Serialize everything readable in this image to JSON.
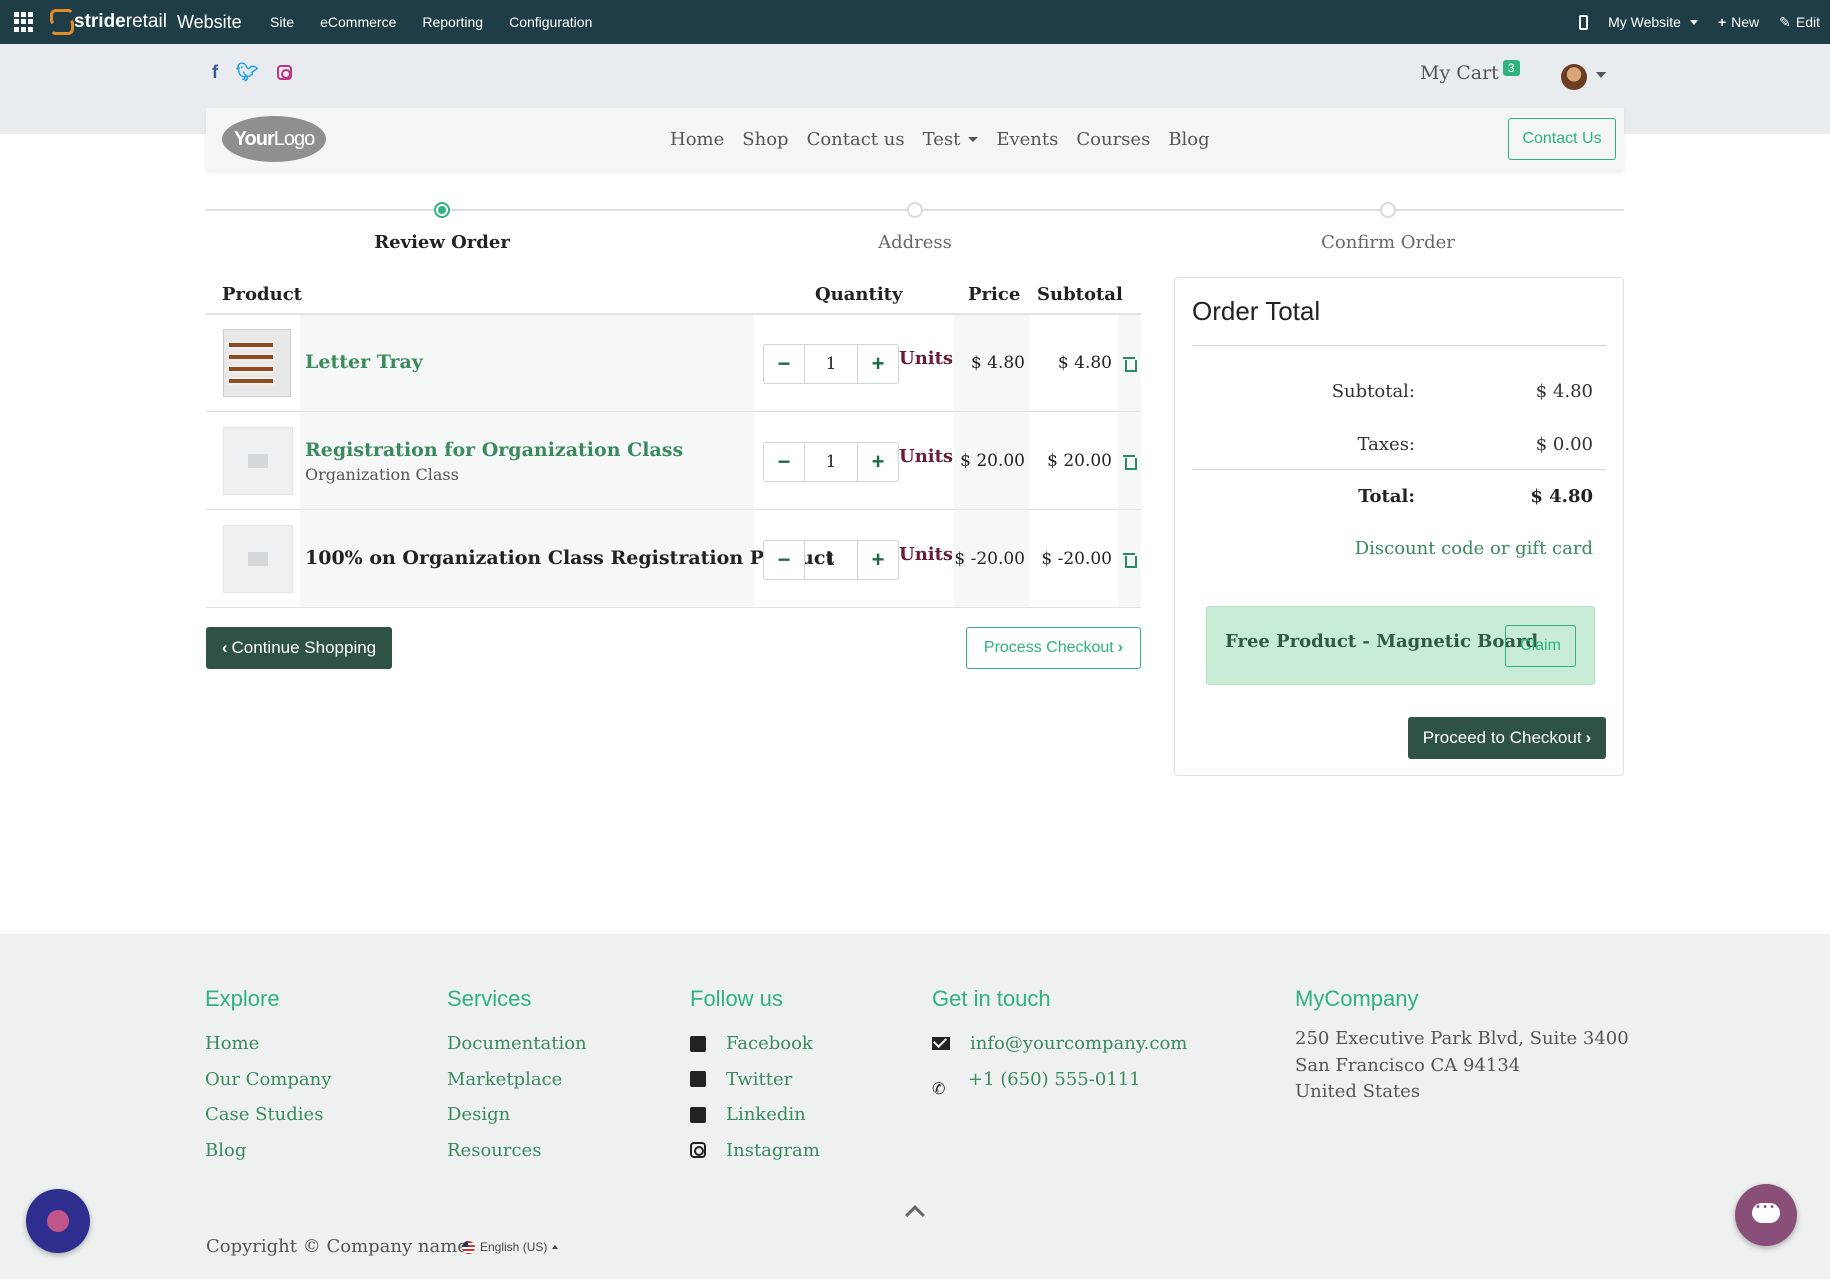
{
  "admin_bar": {
    "brand_a": "stride",
    "brand_b": "retail",
    "app": "Website",
    "menu": [
      "Site",
      "eCommerce",
      "Reporting",
      "Configuration"
    ],
    "website_switch": "My Website",
    "new": "New",
    "edit": "Edit"
  },
  "header": {
    "cart_label": "My Cart",
    "cart_count": "3",
    "logo_a": "Your",
    "logo_b": "Logo",
    "nav": [
      "Home",
      "Shop",
      "Contact us",
      "Test",
      "Events",
      "Courses",
      "Blog"
    ],
    "contact_button": "Contact Us"
  },
  "steps": [
    {
      "label": "Review Order",
      "active": true
    },
    {
      "label": "Address",
      "active": false
    },
    {
      "label": "Confirm Order",
      "active": false
    }
  ],
  "cart_table": {
    "headers": {
      "product": "Product",
      "quantity": "Quantity",
      "price": "Price",
      "subtotal": "Subtotal"
    },
    "rows": [
      {
        "name": "Letter Tray",
        "sub": "",
        "qty": "1",
        "unit": "Units",
        "price": "$ 4.80",
        "subtotal": "$ 4.80",
        "linked": true,
        "thumb": "letter-tray"
      },
      {
        "name": "Registration for Organization Class",
        "sub": "Organization Class",
        "qty": "1",
        "unit": "Units",
        "price": "$ 20.00",
        "subtotal": "$ 20.00",
        "linked": true,
        "thumb": "placeholder"
      },
      {
        "name": "100% on Organization Class Registration Product",
        "sub": "",
        "qty": "1",
        "unit": "Units",
        "price": "$ -20.00",
        "subtotal": "$ -20.00",
        "linked": false,
        "thumb": "placeholder"
      }
    ]
  },
  "buttons": {
    "continue": "Continue Shopping",
    "process": "Process Checkout",
    "proceed": "Proceed to Checkout"
  },
  "order_total": {
    "title": "Order Total",
    "subtotal_label": "Subtotal:",
    "subtotal_value": "$ 4.80",
    "taxes_label": "Taxes:",
    "taxes_value": "$ 0.00",
    "total_label": "Total:",
    "total_value": "$ 4.80",
    "discount_link": "Discount code or gift card",
    "promo_text": "Free Product - Magnetic Board",
    "claim": "Claim"
  },
  "footer": {
    "explore": {
      "title": "Explore",
      "links": [
        "Home",
        "Our Company",
        "Case Studies",
        "Blog"
      ]
    },
    "services": {
      "title": "Services",
      "links": [
        "Documentation",
        "Marketplace",
        "Design",
        "Resources"
      ]
    },
    "follow": {
      "title": "Follow us",
      "links": [
        "Facebook",
        "Twitter",
        "Linkedin",
        "Instagram"
      ]
    },
    "contact": {
      "title": "Get in touch",
      "email": "info@yourcompany.com",
      "phone": "+1 (650) 555-0111"
    },
    "company": {
      "title": "MyCompany",
      "address": [
        "250 Executive Park Blvd, Suite 3400",
        "San Francisco CA 94134",
        "United States"
      ]
    },
    "copyright": "Copyright © Company name",
    "language": "English (US)"
  },
  "colors": {
    "accent": "#2fb27f",
    "dark_green": "#2e5244",
    "admin_bar": "#1f3d47",
    "unit_text": "#6b1b3a"
  }
}
